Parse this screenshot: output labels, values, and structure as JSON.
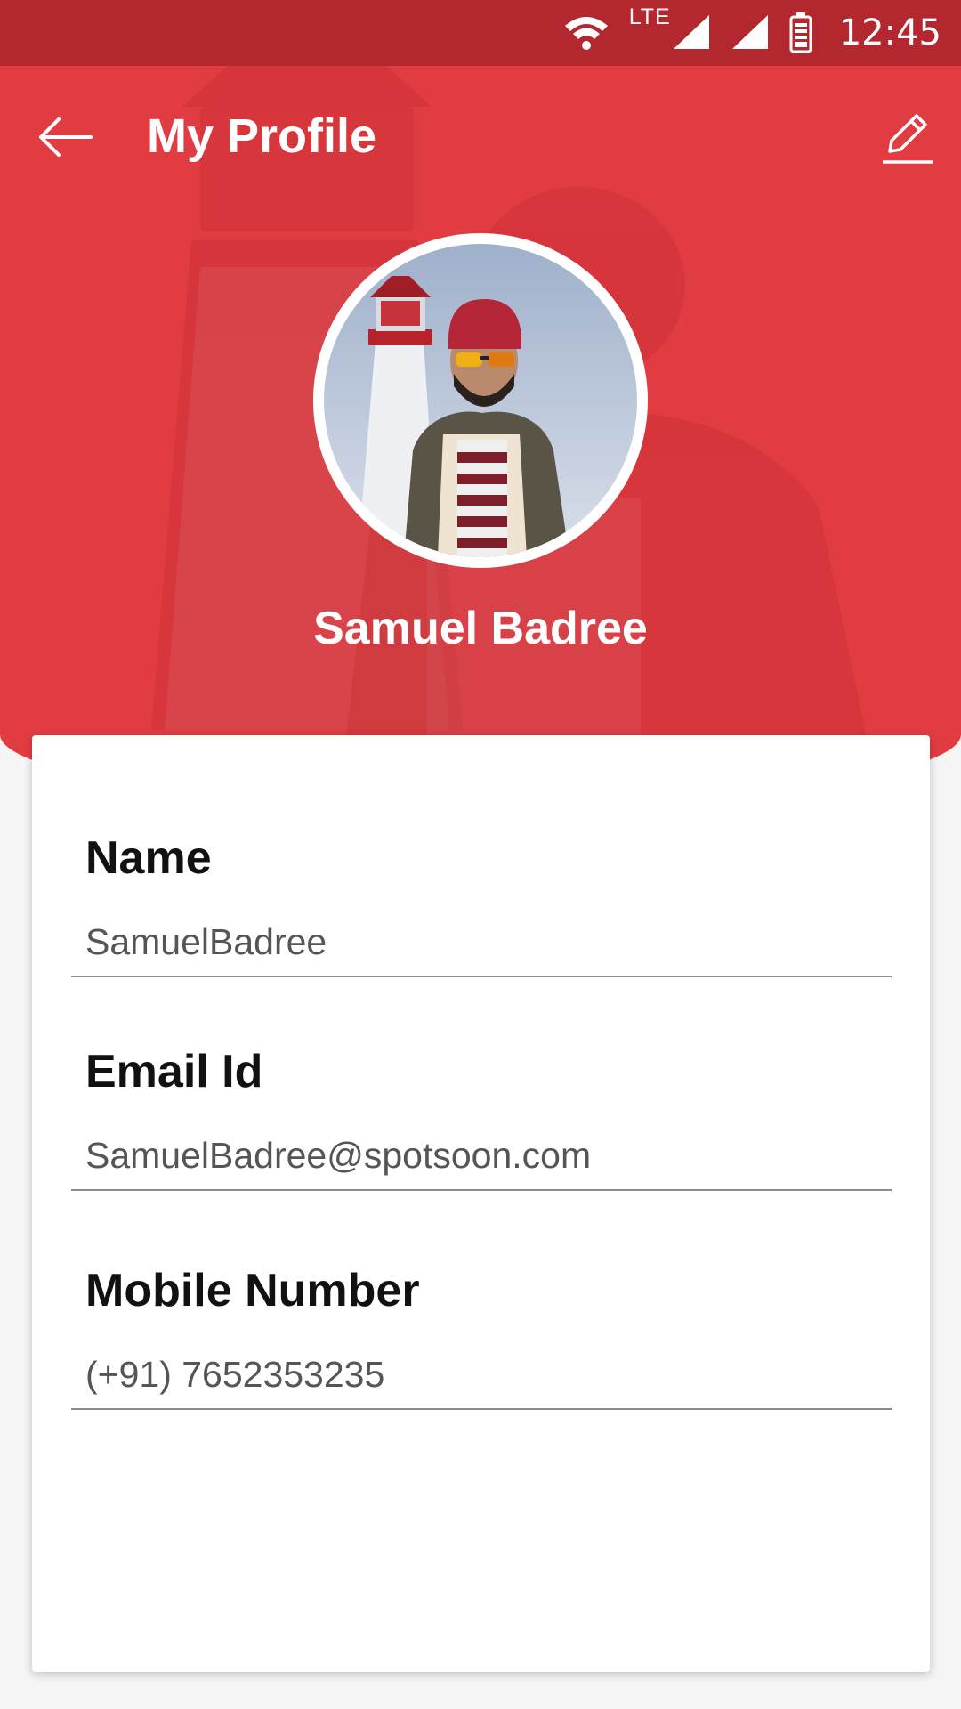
{
  "status_bar": {
    "network_label": "LTE",
    "time": "12:45",
    "icons": [
      "wifi-icon",
      "lte-signal-icon",
      "signal-icon",
      "battery-icon"
    ]
  },
  "app_bar": {
    "title": "My Profile",
    "back_icon": "arrow-left-icon",
    "edit_icon": "pencil-icon"
  },
  "profile": {
    "display_name": "Samuel Badree",
    "avatar": "profile-photo"
  },
  "fields": [
    {
      "label": "Name",
      "value": "SamuelBadree"
    },
    {
      "label": "Email Id",
      "value": "SamuelBadree@spotsoon.com"
    },
    {
      "label": "Mobile Number",
      "value": "(+91) 7652353235"
    }
  ],
  "colors": {
    "primary": "#e13c42",
    "status_bar": "#b3282f",
    "card_background": "#ffffff",
    "page_background": "#f5f5f5",
    "label_text": "#111111",
    "value_text": "#555555"
  }
}
